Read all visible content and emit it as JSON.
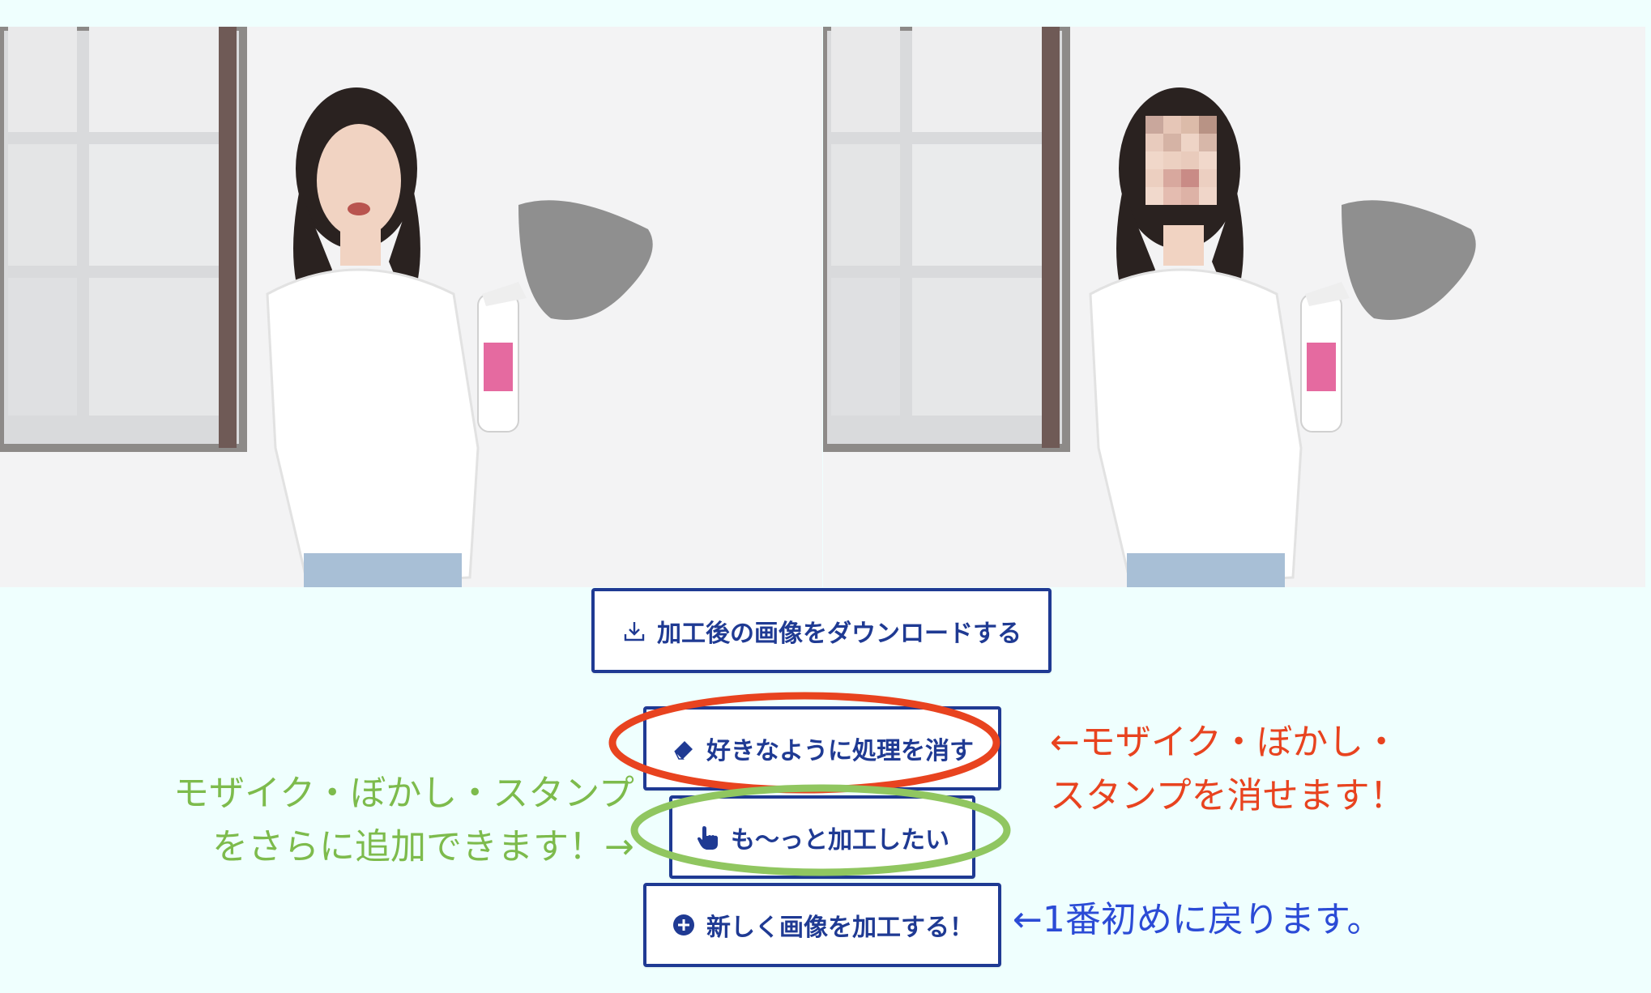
{
  "photos": {
    "before_label": "",
    "after_label": ""
  },
  "buttons": {
    "download": {
      "label": "加工後の画像をダウンロードする",
      "icon": "download-icon"
    },
    "erase": {
      "label": "好きなように処理を消す",
      "icon": "eraser-icon"
    },
    "more": {
      "label": "も〜っと加工したい",
      "icon": "pointer-hand-icon"
    },
    "new": {
      "label": "新しく画像を加工する！",
      "icon": "plus-circle-icon"
    }
  },
  "annotations": {
    "erase_line1": "←モザイク・ぼかし・",
    "erase_line2": "スタンプを消せます！",
    "add_line1": "モザイク・ぼかし・スタンプ",
    "add_line2": "をさらに追加できます！→",
    "new_line1": "←1番初めに戻ります。"
  },
  "colors": {
    "background": "#effffe",
    "button_border": "#1f3a93",
    "annot_red": "#e8431f",
    "annot_green": "#7dbb4c",
    "annot_blue": "#2b4bd6"
  }
}
